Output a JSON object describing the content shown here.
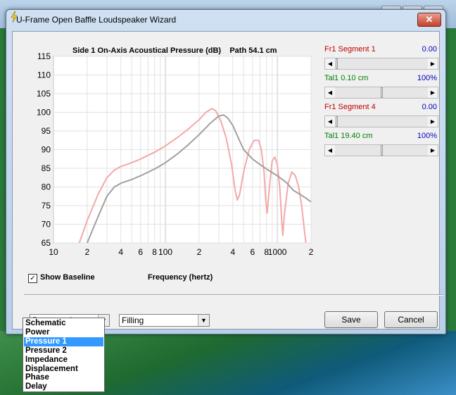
{
  "window": {
    "title": "U-Frame Open Baffle Loudspeaker Wizard",
    "close_glyph": "✕",
    "icon": "lightning-icon"
  },
  "chart_title": "Side 1 On-Axis Acoustical Pressure (dB)    Path 54.1 cm",
  "show_baseline": {
    "label": "Show Baseline",
    "checked": true,
    "check_glyph": "✓"
  },
  "segments": [
    {
      "name": "Fr1  Segment 1",
      "value": "0.00",
      "position": 0.0
    },
    {
      "name": "Tal1  0.10 cm",
      "value": "100%",
      "position": 0.5
    },
    {
      "name": "Fr1  Segment 4",
      "value": "0.00",
      "position": 0.0
    },
    {
      "name": "Tal1  19.40 cm",
      "value": "100%",
      "position": 0.5
    }
  ],
  "scroll_left_glyph": "◀",
  "scroll_right_glyph": "▶",
  "combo_arrow_glyph": "▼",
  "view_select": {
    "value": "Pressure 1"
  },
  "fill_select": {
    "value": "Filling"
  },
  "buttons": {
    "save": "Save",
    "cancel": "Cancel"
  },
  "dropdown_options": [
    "Schematic",
    "Power",
    "Pressure 1",
    "Pressure 2",
    "Impedance",
    "Displacement",
    "Phase",
    "Delay"
  ],
  "dropdown_selected": 2,
  "colors": {
    "pressure_curve": "#f4a8a8",
    "baseline_curve": "#a0a0a0",
    "selection": "#3399ff"
  },
  "chart_data": {
    "type": "line",
    "title": "Side 1 On-Axis Acoustical Pressure (dB)    Path 54.1 cm",
    "xlabel": "Frequency (hertz)",
    "ylabel": "",
    "x_scale": "log",
    "xlim": [
      10,
      2000
    ],
    "ylim": [
      65,
      115
    ],
    "y_ticks": [
      65,
      70,
      75,
      80,
      85,
      90,
      95,
      100,
      105,
      110,
      115
    ],
    "x_ticks": [
      {
        "v": 10,
        "label": "10"
      },
      {
        "v": 20,
        "label": "2"
      },
      {
        "v": 40,
        "label": "4"
      },
      {
        "v": 60,
        "label": "6"
      },
      {
        "v": 80,
        "label": "8"
      },
      {
        "v": 100,
        "label": "100"
      },
      {
        "v": 200,
        "label": "2"
      },
      {
        "v": 400,
        "label": "4"
      },
      {
        "v": 600,
        "label": "6"
      },
      {
        "v": 800,
        "label": "8"
      },
      {
        "v": 1000,
        "label": "1000"
      },
      {
        "v": 2000,
        "label": "2"
      }
    ],
    "grid": true,
    "series": [
      {
        "points": [
          [
            17,
            65
          ],
          [
            20,
            71
          ],
          [
            25,
            78
          ],
          [
            30,
            82.5
          ],
          [
            35,
            84.5
          ],
          [
            40,
            85.5
          ],
          [
            50,
            86.5
          ],
          [
            60,
            87.5
          ],
          [
            80,
            89.3
          ],
          [
            100,
            91
          ],
          [
            130,
            93.4
          ],
          [
            160,
            95.5
          ],
          [
            200,
            98
          ],
          [
            230,
            100
          ],
          [
            260,
            101
          ],
          [
            280,
            100.5
          ],
          [
            310,
            98
          ],
          [
            350,
            93
          ],
          [
            390,
            86
          ],
          [
            420,
            79
          ],
          [
            440,
            76.5
          ],
          [
            460,
            78
          ],
          [
            500,
            84
          ],
          [
            560,
            90
          ],
          [
            620,
            92.5
          ],
          [
            680,
            92.5
          ],
          [
            720,
            90
          ],
          [
            760,
            84
          ],
          [
            790,
            76
          ],
          [
            810,
            73
          ],
          [
            850,
            80
          ],
          [
            900,
            87
          ],
          [
            950,
            88
          ],
          [
            1000,
            86
          ],
          [
            1050,
            80
          ],
          [
            1100,
            70
          ],
          [
            1120,
            67
          ],
          [
            1150,
            72
          ],
          [
            1250,
            81
          ],
          [
            1350,
            84
          ],
          [
            1450,
            83
          ],
          [
            1550,
            80
          ],
          [
            1650,
            75
          ],
          [
            1750,
            68
          ],
          [
            1800,
            65
          ]
        ]
      },
      {
        "points": [
          [
            20,
            65
          ],
          [
            25,
            72
          ],
          [
            30,
            77.5
          ],
          [
            35,
            80
          ],
          [
            40,
            81
          ],
          [
            50,
            82
          ],
          [
            60,
            83
          ],
          [
            80,
            84.8
          ],
          [
            100,
            86.5
          ],
          [
            130,
            89
          ],
          [
            160,
            91.3
          ],
          [
            200,
            94
          ],
          [
            250,
            97
          ],
          [
            300,
            99
          ],
          [
            330,
            99.3
          ],
          [
            360,
            98.5
          ],
          [
            400,
            96.5
          ],
          [
            450,
            93
          ],
          [
            500,
            90
          ],
          [
            600,
            87.5
          ],
          [
            700,
            86
          ],
          [
            800,
            84.8
          ],
          [
            1000,
            83
          ],
          [
            1200,
            81.2
          ],
          [
            1400,
            79
          ],
          [
            1600,
            78
          ],
          [
            1800,
            77
          ],
          [
            2000,
            76
          ]
        ]
      }
    ]
  }
}
